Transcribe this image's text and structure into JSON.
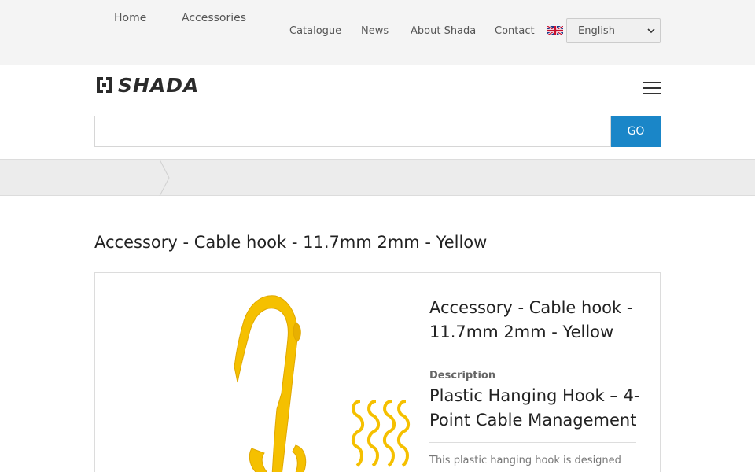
{
  "nav": {
    "items": [
      "Catalogue",
      "News",
      "About Shada",
      "Contact"
    ],
    "language": "English"
  },
  "logo": {
    "text": "SHADA"
  },
  "search": {
    "value": "",
    "placeholder": "",
    "button": "GO"
  },
  "breadcrumb": [
    "Home",
    "Accessories"
  ],
  "page": {
    "title": "Accessory - Cable hook - 11.7mm 2mm - Yellow"
  },
  "product": {
    "title": "Accessory - Cable hook - 11.7mm 2mm - Yellow",
    "description_label": "Description",
    "description_heading": "Plastic Hanging Hook – 4-Point Cable Management",
    "description_text": "This plastic hanging hook is designed",
    "image_color": "#f5c000"
  },
  "colors": {
    "accent": "#1a86c8",
    "topbar_bg": "#f4f4f4",
    "crumb_bg": "#ececec"
  }
}
